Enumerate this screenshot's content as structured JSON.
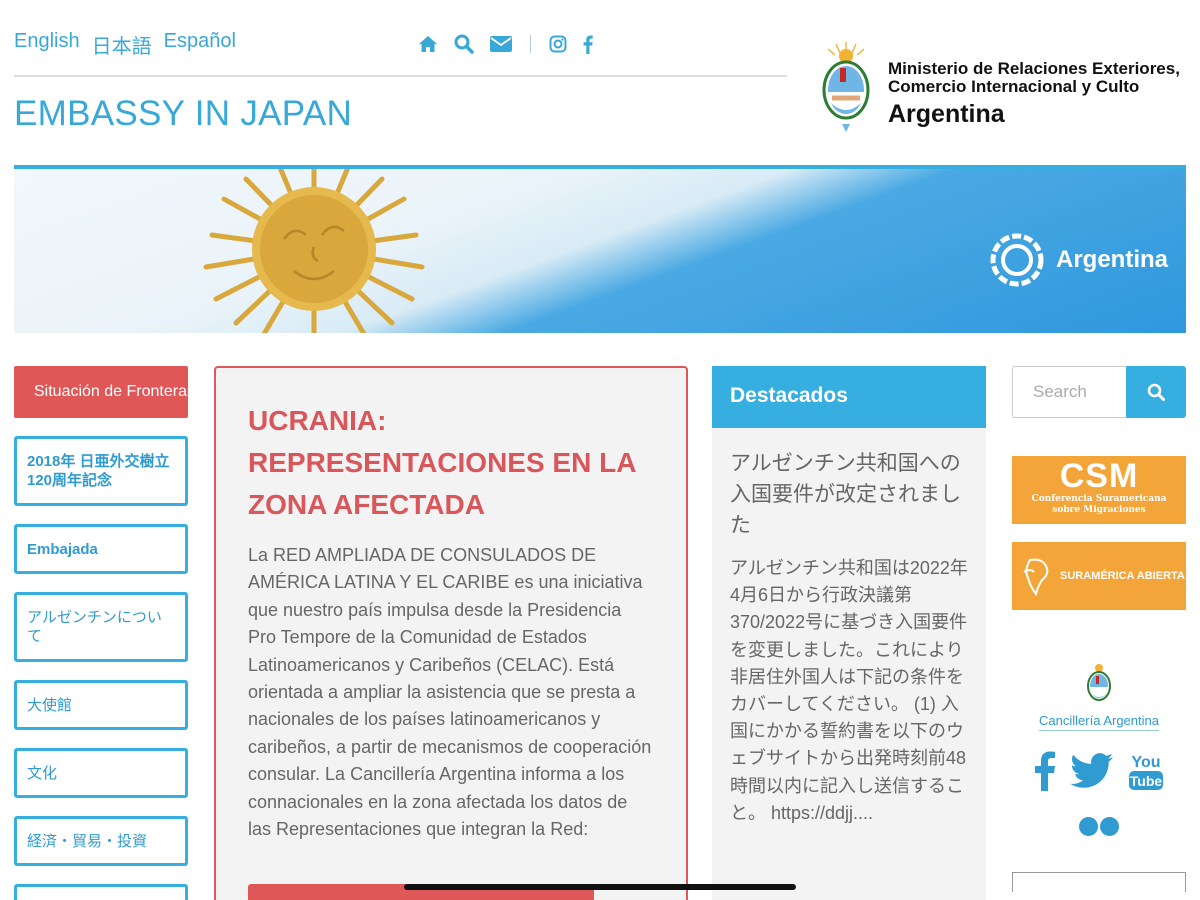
{
  "languages": [
    "English",
    "日本語",
    "Español"
  ],
  "header": {
    "title": "EMBASSY IN JAPAN",
    "ministry_line1": "Ministerio de Relaciones Exteriores,",
    "ministry_line2": "Comercio Internacional y Culto",
    "ministry_country": "Argentina"
  },
  "banner": {
    "brand": "Argentina"
  },
  "left_menu": {
    "alert_button": "Situación de Fronteras",
    "items": [
      "2018年 日亜外交樹立120周年記念",
      "Embajada",
      "アルゼンチンについて",
      "大使館",
      "文化",
      "経済・貿易・投資"
    ]
  },
  "article": {
    "title": "UCRANIA: REPRESENTACIONES EN LA ZONA AFECTADA",
    "body": "La RED AMPLIADA DE CONSULADOS DE AMÉRICA LATINA Y EL CARIBE es una iniciativa que nuestro país impulsa desde la Presidencia Pro Tempore de la Comunidad de Estados Latinoamericanos y Caribeños (CELAC). Está orientada a ampliar la asistencia que se presta a nacionales de los países latinoamericanos y caribeños, a partir de mecanismos de cooperación consular. La Cancillería Argentina informa a los connacionales en la zona afectada los datos de las Representaciones que integran la Red:"
  },
  "destacados": {
    "heading": "Destacados",
    "item_title": "アルゼンチン共和国への入国要件が改定されました",
    "item_text": "アルゼンチン共和国は2022年4月6日から行政決議第370/2022号に基づき入国要件を変更しました。これにより非居住外国人は下記の条件をカバーしてください。 (1) 入国にかかる誓約書を以下のウェブサイトから出発時刻前48時間以内に記入し送信すること。 https://ddjj...."
  },
  "right": {
    "search_placeholder": "Search",
    "csm_title": "CSM",
    "csm_sub1": "Conferencia Suramericana",
    "csm_sub2": "sobre Migraciones",
    "sura_label": "SURAMÉRICA ABIERTA",
    "cancilleria_label": "Cancillería Argentina"
  },
  "colors": {
    "accent": "#36aee0",
    "alert": "#e05757",
    "orange": "#f4a53a"
  }
}
